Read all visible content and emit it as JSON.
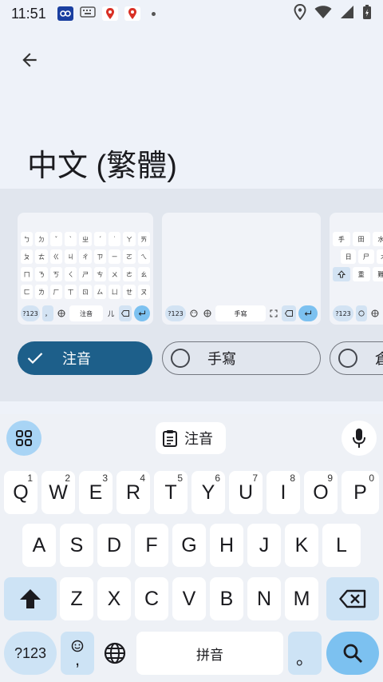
{
  "status": {
    "time": "11:51"
  },
  "page": {
    "title": "中文 (繁體)"
  },
  "layouts": [
    {
      "label": "注音",
      "selected": true
    },
    {
      "label": "手寫",
      "selected": false
    },
    {
      "label": "倉",
      "selected": false
    }
  ],
  "thumb1": {
    "rows": [
      [
        "ㄅ",
        "ㄉ",
        "ˇ",
        "ˋ",
        "ㄓ",
        "ˊ",
        "˙",
        "ㄚ",
        "ㄞ"
      ],
      [
        "ㄆ",
        "ㄊ",
        "ㄍ",
        "ㄐ",
        "ㄔ",
        "ㄗ",
        "ㄧ",
        "ㄛ",
        "ㄟ"
      ],
      [
        "ㄇ",
        "ㄋ",
        "ㄎ",
        "ㄑ",
        "ㄕ",
        "ㄘ",
        "ㄨ",
        "ㄜ",
        "ㄠ"
      ],
      [
        "ㄈ",
        "ㄌ",
        "ㄏ",
        "ㄒ",
        "ㄖ",
        "ㄙ",
        "ㄩ",
        "ㄝ",
        "ㄡ"
      ]
    ],
    "sym": "?123",
    "comma": "，",
    "space": "注音",
    "char": "儿"
  },
  "thumb2": {
    "sym": "?123",
    "space": "手寫"
  },
  "thumb3": {
    "rows": [
      [
        "手",
        "田",
        "水",
        "口"
      ],
      [
        "日",
        "尸",
        "木",
        "火"
      ],
      [
        "重",
        "難",
        "金"
      ]
    ],
    "sym": "?123"
  },
  "toolbar": {
    "mode_label": "注音"
  },
  "keyboard": {
    "row1": [
      {
        "k": "Q",
        "h": "1"
      },
      {
        "k": "W",
        "h": "2"
      },
      {
        "k": "E",
        "h": "3"
      },
      {
        "k": "R",
        "h": "4"
      },
      {
        "k": "T",
        "h": "5"
      },
      {
        "k": "Y",
        "h": "6"
      },
      {
        "k": "U",
        "h": "7"
      },
      {
        "k": "I",
        "h": "8"
      },
      {
        "k": "O",
        "h": "9"
      },
      {
        "k": "P",
        "h": "0"
      }
    ],
    "row2": [
      "A",
      "S",
      "D",
      "F",
      "G",
      "H",
      "J",
      "K",
      "L"
    ],
    "row3": [
      "Z",
      "X",
      "C",
      "V",
      "B",
      "N",
      "M"
    ],
    "symbols": "?123",
    "comma": ",",
    "space": "拼音",
    "period": "。"
  }
}
